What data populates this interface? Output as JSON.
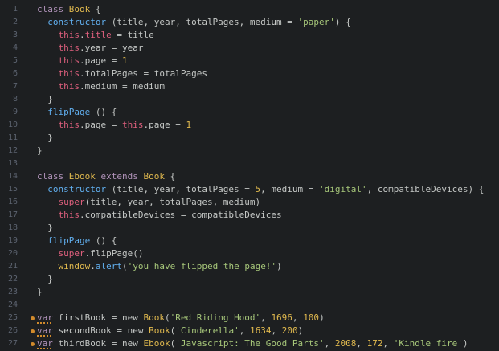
{
  "colors": {
    "background": "#1d1f21",
    "line_number": "#5c6370",
    "plain": "#c5c8c6",
    "keyword": "#b294bb",
    "type": "#e0b94e",
    "function": "#61afef",
    "this": "#e0607e",
    "string": "#a7c77a",
    "number": "#e0b94e",
    "warning_marker": "#d08a2c"
  },
  "editor": {
    "lines": [
      {
        "n": "1",
        "indent": "",
        "tokens": [
          {
            "t": "kw",
            "v": "class"
          },
          {
            "t": "pl",
            "v": " "
          },
          {
            "t": "ty",
            "v": "Book"
          },
          {
            "t": "pl",
            "v": " {"
          }
        ]
      },
      {
        "n": "2",
        "indent": "  ",
        "tokens": [
          {
            "t": "fn",
            "v": "constructor"
          },
          {
            "t": "pl",
            "v": " (title, year, totalPages, medium = "
          },
          {
            "t": "st",
            "v": "'paper'"
          },
          {
            "t": "pl",
            "v": ") {"
          }
        ]
      },
      {
        "n": "3",
        "indent": "    ",
        "tokens": [
          {
            "t": "th",
            "v": "this"
          },
          {
            "t": "pl",
            "v": "."
          },
          {
            "t": "th",
            "v": "title"
          },
          {
            "t": "pl",
            "v": " = title"
          }
        ]
      },
      {
        "n": "4",
        "indent": "    ",
        "tokens": [
          {
            "t": "th",
            "v": "this"
          },
          {
            "t": "pl",
            "v": ".year = year"
          }
        ]
      },
      {
        "n": "5",
        "indent": "    ",
        "tokens": [
          {
            "t": "th",
            "v": "this"
          },
          {
            "t": "pl",
            "v": ".page = "
          },
          {
            "t": "nu",
            "v": "1"
          }
        ]
      },
      {
        "n": "6",
        "indent": "    ",
        "tokens": [
          {
            "t": "th",
            "v": "this"
          },
          {
            "t": "pl",
            "v": ".totalPages = totalPages"
          }
        ]
      },
      {
        "n": "7",
        "indent": "    ",
        "tokens": [
          {
            "t": "th",
            "v": "this"
          },
          {
            "t": "pl",
            "v": ".medium = medium"
          }
        ]
      },
      {
        "n": "8",
        "indent": "  ",
        "tokens": [
          {
            "t": "pl",
            "v": "}"
          }
        ]
      },
      {
        "n": "9",
        "indent": "  ",
        "tokens": [
          {
            "t": "fn",
            "v": "flipPage"
          },
          {
            "t": "pl",
            "v": " () {"
          }
        ]
      },
      {
        "n": "10",
        "indent": "    ",
        "tokens": [
          {
            "t": "th",
            "v": "this"
          },
          {
            "t": "pl",
            "v": ".page = "
          },
          {
            "t": "th",
            "v": "this"
          },
          {
            "t": "pl",
            "v": ".page + "
          },
          {
            "t": "nu",
            "v": "1"
          }
        ]
      },
      {
        "n": "11",
        "indent": "  ",
        "tokens": [
          {
            "t": "pl",
            "v": "}"
          }
        ]
      },
      {
        "n": "12",
        "indent": "",
        "tokens": [
          {
            "t": "pl",
            "v": "}"
          }
        ]
      },
      {
        "n": "13",
        "indent": "",
        "tokens": []
      },
      {
        "n": "14",
        "indent": "",
        "tokens": [
          {
            "t": "kw",
            "v": "class"
          },
          {
            "t": "pl",
            "v": " "
          },
          {
            "t": "ty",
            "v": "Ebook"
          },
          {
            "t": "pl",
            "v": " "
          },
          {
            "t": "kw",
            "v": "extends"
          },
          {
            "t": "pl",
            "v": " "
          },
          {
            "t": "ty",
            "v": "Book"
          },
          {
            "t": "pl",
            "v": " {"
          }
        ]
      },
      {
        "n": "15",
        "indent": "  ",
        "tokens": [
          {
            "t": "fn",
            "v": "constructor"
          },
          {
            "t": "pl",
            "v": " (title, year, totalPages = "
          },
          {
            "t": "nu",
            "v": "5"
          },
          {
            "t": "pl",
            "v": ", medium = "
          },
          {
            "t": "st",
            "v": "'digital'"
          },
          {
            "t": "pl",
            "v": ", compatibleDevices) {"
          }
        ]
      },
      {
        "n": "16",
        "indent": "    ",
        "tokens": [
          {
            "t": "th",
            "v": "super"
          },
          {
            "t": "pl",
            "v": "(title, year, totalPages, medium)"
          }
        ]
      },
      {
        "n": "17",
        "indent": "    ",
        "tokens": [
          {
            "t": "th",
            "v": "this"
          },
          {
            "t": "pl",
            "v": ".compatibleDevices = compatibleDevices"
          }
        ]
      },
      {
        "n": "18",
        "indent": "  ",
        "tokens": [
          {
            "t": "pl",
            "v": "}"
          }
        ]
      },
      {
        "n": "19",
        "indent": "  ",
        "tokens": [
          {
            "t": "fn",
            "v": "flipPage"
          },
          {
            "t": "pl",
            "v": " () {"
          }
        ]
      },
      {
        "n": "20",
        "indent": "    ",
        "tokens": [
          {
            "t": "th",
            "v": "super"
          },
          {
            "t": "pl",
            "v": ".flipPage()"
          }
        ]
      },
      {
        "n": "21",
        "indent": "    ",
        "tokens": [
          {
            "t": "bu",
            "v": "window"
          },
          {
            "t": "pl",
            "v": "."
          },
          {
            "t": "fn",
            "v": "alert"
          },
          {
            "t": "pl",
            "v": "("
          },
          {
            "t": "st",
            "v": "'you have flipped the page!'"
          },
          {
            "t": "pl",
            "v": ")"
          }
        ]
      },
      {
        "n": "22",
        "indent": "  ",
        "tokens": [
          {
            "t": "pl",
            "v": "}"
          }
        ]
      },
      {
        "n": "23",
        "indent": "",
        "tokens": [
          {
            "t": "pl",
            "v": "}"
          }
        ]
      },
      {
        "n": "24",
        "indent": "",
        "tokens": []
      },
      {
        "n": "25",
        "indent": "",
        "marker": true,
        "tokens": [
          {
            "t": "kw",
            "v": "var"
          },
          {
            "t": "pl",
            "v": " firstBook = new "
          },
          {
            "t": "ty",
            "v": "Book"
          },
          {
            "t": "pl",
            "v": "("
          },
          {
            "t": "st",
            "v": "'Red Riding Hood'"
          },
          {
            "t": "pl",
            "v": ", "
          },
          {
            "t": "nu",
            "v": "1696"
          },
          {
            "t": "pl",
            "v": ", "
          },
          {
            "t": "nu",
            "v": "100"
          },
          {
            "t": "pl",
            "v": ")"
          }
        ]
      },
      {
        "n": "26",
        "indent": "",
        "marker": true,
        "tokens": [
          {
            "t": "kw",
            "v": "var"
          },
          {
            "t": "pl",
            "v": " secondBook = new "
          },
          {
            "t": "ty",
            "v": "Book"
          },
          {
            "t": "pl",
            "v": "("
          },
          {
            "t": "st",
            "v": "'Cinderella'"
          },
          {
            "t": "pl",
            "v": ", "
          },
          {
            "t": "nu",
            "v": "1634"
          },
          {
            "t": "pl",
            "v": ", "
          },
          {
            "t": "nu",
            "v": "200"
          },
          {
            "t": "pl",
            "v": ")"
          }
        ]
      },
      {
        "n": "27",
        "indent": "",
        "marker": true,
        "tokens": [
          {
            "t": "kw",
            "v": "var"
          },
          {
            "t": "pl",
            "v": " thirdBook = new "
          },
          {
            "t": "ty",
            "v": "Ebook"
          },
          {
            "t": "pl",
            "v": "("
          },
          {
            "t": "st",
            "v": "'Javascript: The Good Parts'"
          },
          {
            "t": "pl",
            "v": ", "
          },
          {
            "t": "nu",
            "v": "2008"
          },
          {
            "t": "pl",
            "v": ", "
          },
          {
            "t": "nu",
            "v": "172"
          },
          {
            "t": "pl",
            "v": ", "
          },
          {
            "t": "st",
            "v": "'Kindle fire'"
          },
          {
            "t": "pl",
            "v": ")"
          }
        ]
      }
    ]
  }
}
